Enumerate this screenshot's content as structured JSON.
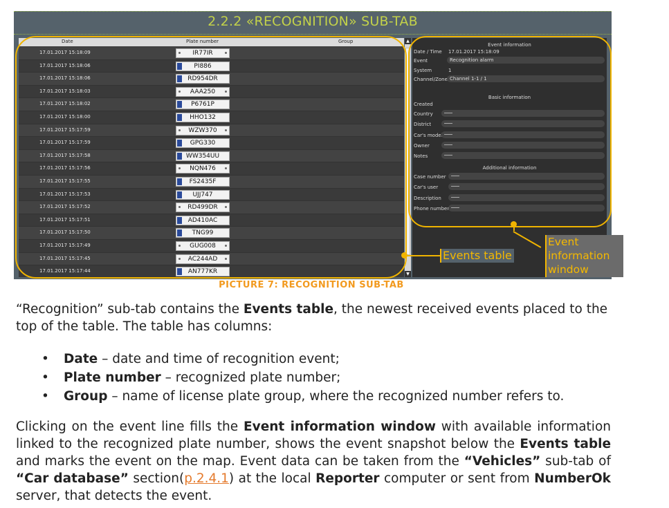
{
  "section": {
    "title": "2.2.2  «RECOGNITION» SUB-TAB"
  },
  "table": {
    "headers": {
      "date": "Date",
      "plate": "Plate number",
      "group": "Group"
    },
    "rows": [
      {
        "date": "17.01.2017 15:18:09",
        "plate": "IR77IR"
      },
      {
        "date": "17.01.2017 15:18:06",
        "plate": "PI886"
      },
      {
        "date": "17.01.2017 15:18:06",
        "plate": "RD954DR"
      },
      {
        "date": "17.01.2017 15:18:03",
        "plate": "AAA250"
      },
      {
        "date": "17.01.2017 15:18:02",
        "plate": "P6761P"
      },
      {
        "date": "17.01.2017 15:18:00",
        "plate": "HHO132"
      },
      {
        "date": "17.01.2017 15:17:59",
        "plate": "WZW370"
      },
      {
        "date": "17.01.2017 15:17:59",
        "plate": "GPG330"
      },
      {
        "date": "17.01.2017 15:17:58",
        "plate": "WW354UU"
      },
      {
        "date": "17.01.2017 15:17:56",
        "plate": "NQN476"
      },
      {
        "date": "17.01.2017 15:17:55",
        "plate": "FS2435F"
      },
      {
        "date": "17.01.2017 15:17:53",
        "plate": "UJJ747"
      },
      {
        "date": "17.01.2017 15:17:52",
        "plate": "RD499DR"
      },
      {
        "date": "17.01.2017 15:17:51",
        "plate": "AD410AC"
      },
      {
        "date": "17.01.2017 15:17:50",
        "plate": "TNG99"
      },
      {
        "date": "17.01.2017 15:17:49",
        "plate": "GUG008"
      },
      {
        "date": "17.01.2017 15:17:45",
        "plate": "AC244AD"
      },
      {
        "date": "17.01.2017 15:17:44",
        "plate": "AN777KR"
      }
    ]
  },
  "info": {
    "title": "Event information",
    "labels": {
      "datetime": "Date / Time",
      "event": "Event",
      "system": "System",
      "channel": "Channel/Zone",
      "created": "Created",
      "country": "Country",
      "district": "District",
      "model": "Car's model",
      "owner": "Owner",
      "notes": "Notes",
      "case": "Case number",
      "user": "Car's user",
      "desc": "Description",
      "phone": "Phone number"
    },
    "values": {
      "datetime": "17.01.2017 15:18:09",
      "event": "Recognition alarm",
      "system": "1",
      "channel": "Channel 1-1 / 1"
    },
    "basic": "Basic information",
    "additional": "Additional information"
  },
  "callouts": {
    "events_table": "Events table",
    "event_info": "Event information window"
  },
  "caption": "PICTURE 7: RECOGNITION SUB-TAB",
  "text": {
    "p1a": "“Recognition” sub-tab contains the ",
    "p1b": "Events table",
    "p1c": ", the newest received events placed to the top of the table. The table has columns:",
    "b1a": "Date",
    "b1b": " – date and time of recognition event;",
    "b2a": "Plate number",
    "b2b": " – recognized plate number;",
    "b3a": "Group",
    "b3b": " – name of license plate group, where the recognized number refers to.",
    "p2a": "Clicking on the event line fills the ",
    "p2b": "Event information window",
    "p2c": " with available information linked to the recognized plate number, shows the event snapshot below the ",
    "p2d": "Events table",
    "p2e": " and marks the event on the map. Event data can be taken from the ",
    "p2f": "“Vehicles”",
    "p2g": " sub-tab of ",
    "p2h": "“Car database”",
    "p2i": " section(",
    "p2link": "p.2.4.1",
    "p2j": ") at the local ",
    "p2k": "Reporter",
    "p2l": " computer or sent from ",
    "p2m": "NumberOk",
    "p2n": " server, that detects the event."
  }
}
